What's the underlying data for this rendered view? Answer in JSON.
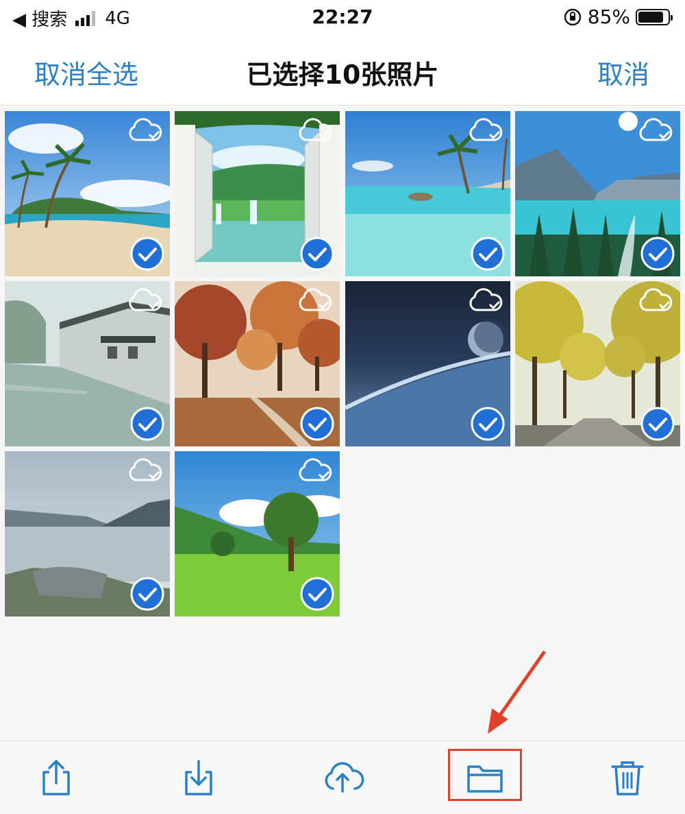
{
  "status_bar": {
    "back_label": "◀ 搜索",
    "network": "4G",
    "time": "22:27",
    "battery": "85%",
    "battery_level": 0.85,
    "signal_bars": 3
  },
  "nav": {
    "left_action": "取消全选",
    "title": "已选择10张照片",
    "right_action": "取消"
  },
  "photos": [
    {
      "scene": "tropical-beach",
      "icloud": "cloud-check-icon",
      "selected": true
    },
    {
      "scene": "window-waterfall",
      "icloud": "cloud-check-icon",
      "selected": true
    },
    {
      "scene": "turquoise-sea-palm",
      "icloud": "cloud-check-icon",
      "selected": true
    },
    {
      "scene": "mountain-lake-pines",
      "icloud": "cloud-check-icon",
      "selected": true
    },
    {
      "scene": "water-town-canal",
      "icloud": "cloud-check-icon",
      "selected": true
    },
    {
      "scene": "autumn-park",
      "icloud": "cloud-check-icon",
      "selected": true
    },
    {
      "scene": "earth-from-space",
      "icloud": "cloud-check-icon",
      "selected": true
    },
    {
      "scene": "ginkgo-avenue",
      "icloud": "cloud-check-icon",
      "selected": true
    },
    {
      "scene": "misty-lake-rock",
      "icloud": "cloud-check-icon",
      "selected": true
    },
    {
      "scene": "green-meadow-tree",
      "icloud": "cloud-check-icon",
      "selected": true
    }
  ],
  "toolbar": {
    "items": [
      "share-icon",
      "download-icon",
      "cloud-upload-icon",
      "folder-icon",
      "trash-icon"
    ],
    "highlighted": "folder-icon"
  },
  "colors": {
    "accent": "#2a7fc5",
    "check_fill": "#1f6fd6",
    "annotation": "#e0412a"
  }
}
